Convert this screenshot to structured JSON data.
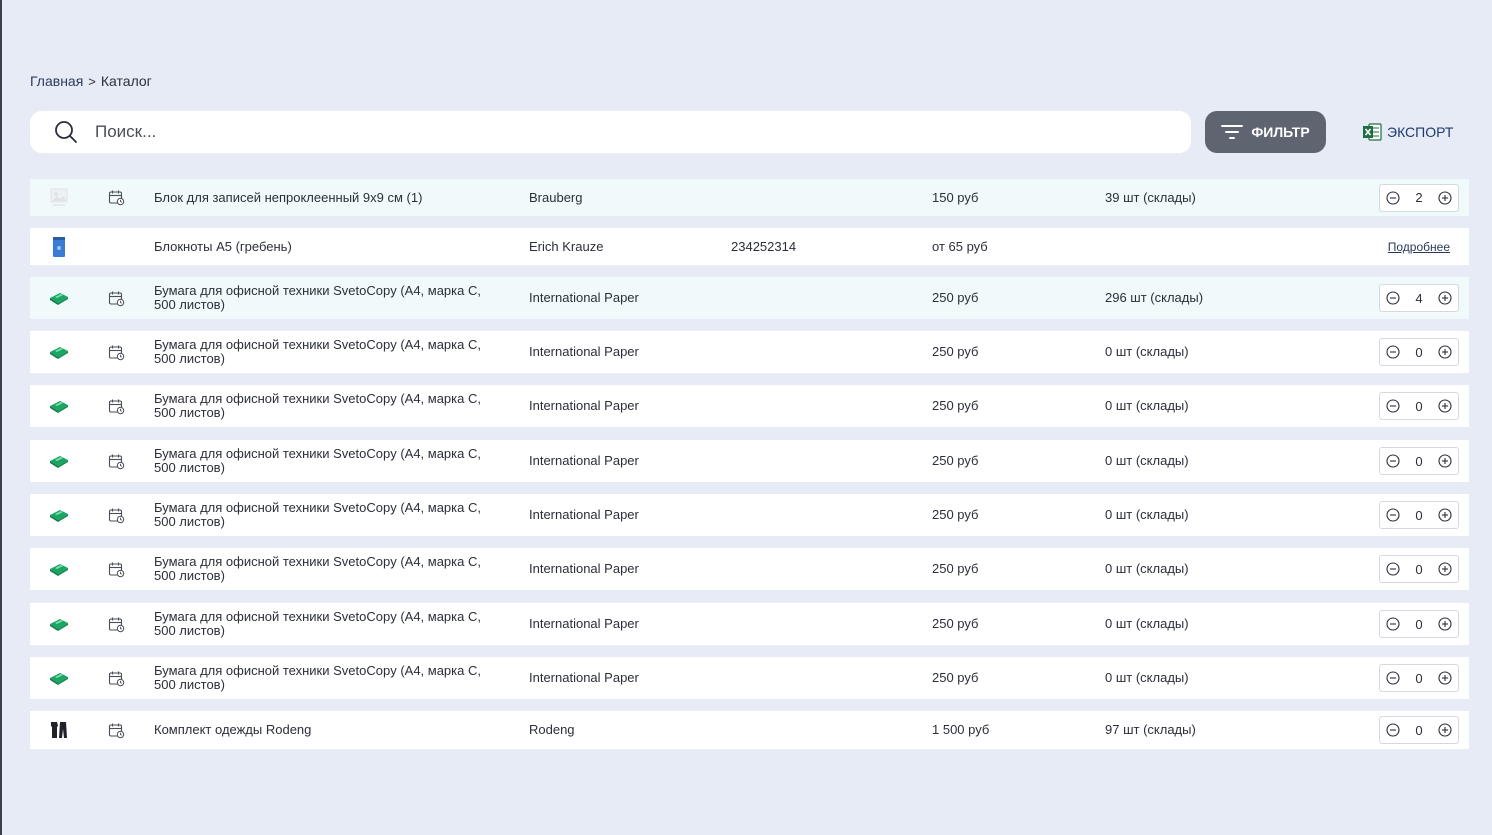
{
  "breadcrumb": {
    "home": "Главная",
    "separator": ">",
    "current": "Каталог"
  },
  "search": {
    "placeholder": "Поиск...",
    "value": ""
  },
  "toolbar": {
    "filter_label": "ФИЛЬТР",
    "export_label": "ЭКСПОРТ"
  },
  "colors": {
    "background": "#e6ebf5",
    "filter_button": "#5e6470",
    "row_highlight": "#f0fafb",
    "excel_green": "#1d6f42",
    "export_text": "#1e3a6e"
  },
  "rows": [
    {
      "image": "no-image-icon",
      "has_calendar": true,
      "name": [
        "Блок для записей непроклеенный 9х9 см (1)"
      ],
      "brand": "Brauberg",
      "code": "",
      "price": "150 руб",
      "stock": "39 шт (склады)",
      "qty": "2",
      "highlight": true
    },
    {
      "image": "notebook-icon",
      "has_calendar": false,
      "name": [
        "Блокноты А5 (гребень)"
      ],
      "brand": "Erich Krauze",
      "code": "234252314",
      "price": "от 65 руб",
      "stock": "",
      "more": "Подробнее",
      "highlight": false
    },
    {
      "image": "paper-ream-icon",
      "has_calendar": true,
      "name": [
        "Бумага для офисной техники SvetoCopy (А4, марка С,",
        "500 листов)"
      ],
      "brand": "International Paper",
      "code": "",
      "price": "250 руб",
      "stock": "296 шт (склады)",
      "qty": "4",
      "highlight": true
    },
    {
      "image": "paper-ream-icon",
      "has_calendar": true,
      "name": [
        "Бумага для офисной техники SvetoCopy (А4, марка С,",
        "500 листов)"
      ],
      "brand": "International Paper",
      "code": "",
      "price": "250 руб",
      "stock": "0 шт (склады)",
      "qty": "0",
      "highlight": false
    },
    {
      "image": "paper-ream-icon",
      "has_calendar": true,
      "name": [
        "Бумага для офисной техники SvetoCopy (А4, марка С,",
        "500 листов)"
      ],
      "brand": "International Paper",
      "code": "",
      "price": "250 руб",
      "stock": "0 шт (склады)",
      "qty": "0",
      "highlight": false
    },
    {
      "image": "paper-ream-icon",
      "has_calendar": true,
      "name": [
        "Бумага для офисной техники SvetoCopy (А4, марка С,",
        "500 листов)"
      ],
      "brand": "International Paper",
      "code": "",
      "price": "250 руб",
      "stock": "0 шт (склады)",
      "qty": "0",
      "highlight": false
    },
    {
      "image": "paper-ream-icon",
      "has_calendar": true,
      "name": [
        "Бумага для офисной техники SvetoCopy (А4, марка С,",
        "500 листов)"
      ],
      "brand": "International Paper",
      "code": "",
      "price": "250 руб",
      "stock": "0 шт (склады)",
      "qty": "0",
      "highlight": false
    },
    {
      "image": "paper-ream-icon",
      "has_calendar": true,
      "name": [
        "Бумага для офисной техники SvetoCopy (А4, марка С,",
        "500 листов)"
      ],
      "brand": "International Paper",
      "code": "",
      "price": "250 руб",
      "stock": "0 шт (склады)",
      "qty": "0",
      "highlight": false
    },
    {
      "image": "paper-ream-icon",
      "has_calendar": true,
      "name": [
        "Бумага для офисной техники SvetoCopy (А4, марка С,",
        "500 листов)"
      ],
      "brand": "International Paper",
      "code": "",
      "price": "250 руб",
      "stock": "0 шт (склады)",
      "qty": "0",
      "highlight": false
    },
    {
      "image": "paper-ream-icon",
      "has_calendar": true,
      "name": [
        "Бумага для офисной техники SvetoCopy (А4, марка С,",
        "500 листов)"
      ],
      "brand": "International Paper",
      "code": "",
      "price": "250 руб",
      "stock": "0 шт (склады)",
      "qty": "0",
      "highlight": false
    },
    {
      "image": "clothing-set-icon",
      "has_calendar": true,
      "name": [
        "Комплект одежды Rodeng"
      ],
      "brand": "Rodeng",
      "code": "",
      "price": "1 500 руб",
      "stock": "97 шт (склады)",
      "qty": "0",
      "highlight": false
    }
  ]
}
